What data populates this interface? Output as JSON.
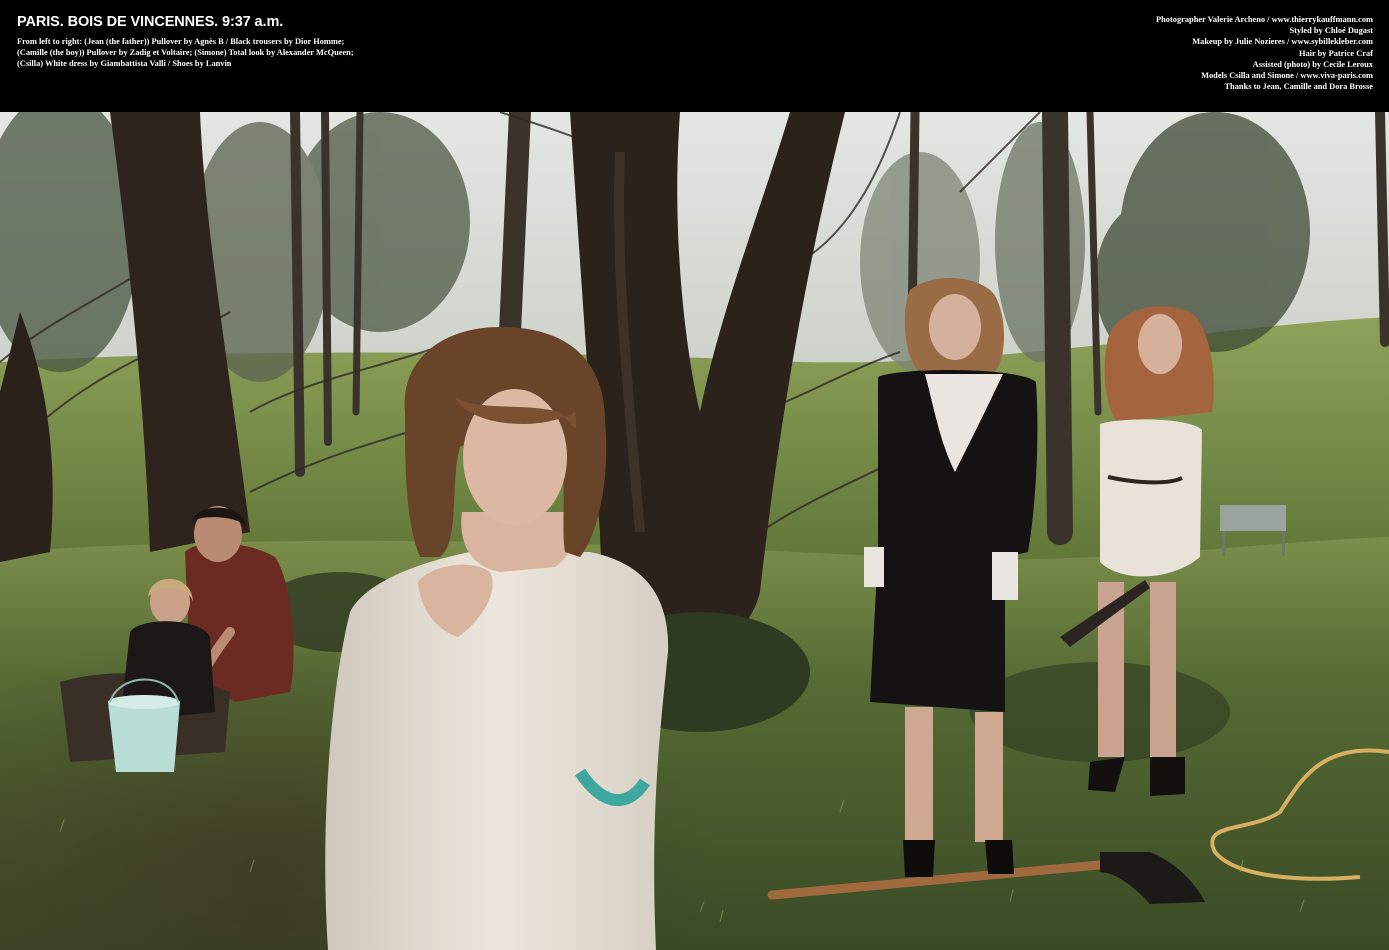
{
  "header": {
    "headline": "PARIS. BOIS DE VINCENNES. 9:37 a.m.",
    "credits_lines": [
      "From left to right: (Jean (the father)) Pullover by Agnès B / Black trousers by Dior Homme;",
      "(Camille (the boy)) Pullover by Zadig et Voltaire; (Simone) Total look by Alexander McQueen;",
      "(Csilla) White dress by Giambattista Valli / Shoes by Lanvin"
    ]
  },
  "credits": {
    "photographer": "Photographer Valerie Archeno / www.thierrykauffmann.com",
    "styling": "Styled by Chloé Dugast",
    "makeup": "Makeup by Julie Nozieres / www.sybillekleber.com",
    "hair": "Hair by Patrice Craf",
    "assistant": "Assisted (photo) by Cecile Leroux",
    "models": "Models Csilla and Simone / www.viva-paris.com",
    "thanks": "Thanks to Jean, Camille and Dora Brosse"
  },
  "colors": {
    "bar": "#000000",
    "text": "#ffffff",
    "sky": "#d9ddd8",
    "grass": "#556b35",
    "trunk": "#2c231d",
    "sweater": "#e6e0d6",
    "black_dress": "#141212",
    "white_dress": "#e8e2d8",
    "bucket": "#b7ddd4",
    "shovel_handle": "#a06a3e"
  }
}
